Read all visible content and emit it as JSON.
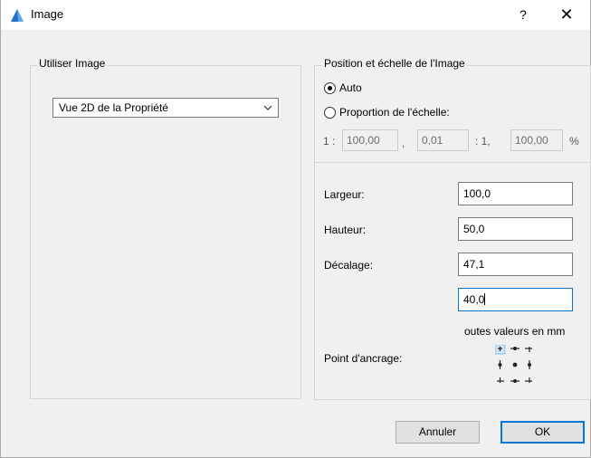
{
  "window": {
    "title": "Image",
    "help_label": "?",
    "close_label": "✕"
  },
  "use_image": {
    "group_title": "Utiliser Image",
    "selected_view": "Vue 2D de la Propriété"
  },
  "position_scale": {
    "group_title": "Position et échelle de l'Image",
    "radio_auto": "Auto",
    "radio_proportion": "Proportion de l'échelle:",
    "selected": "Auto",
    "scale_prefix": "1 :",
    "scale_a": "100,00",
    "sep_comma": ",",
    "scale_b": "0,01",
    "scale_mid": ": 1,",
    "scale_c": "100,00",
    "scale_unit": "%"
  },
  "dimensions": {
    "width_label": "Largeur:",
    "width_value": "100,0",
    "height_label": "Hauteur:",
    "height_value": "50,0",
    "offset_label": "Décalage:",
    "offset_x_value": "47,1",
    "offset_y_value": "40,0",
    "note": "outes valeurs en mm",
    "anchor_label": "Point d'ancrage:",
    "anchor_selected": "top-left"
  },
  "buttons": {
    "cancel": "Annuler",
    "ok": "OK"
  },
  "colors": {
    "accent": "#0078d7",
    "anchor_highlight": "#cce4f7"
  }
}
